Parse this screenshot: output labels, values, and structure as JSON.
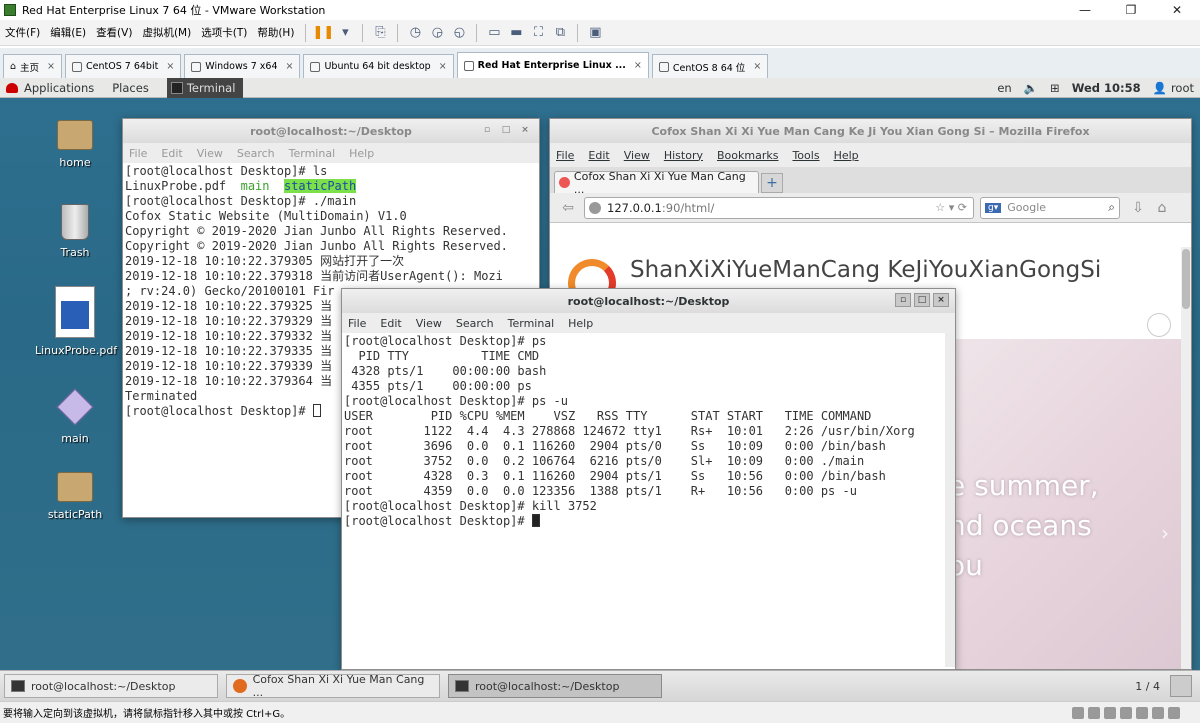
{
  "vmware": {
    "title": "Red Hat Enterprise Linux 7 64 位 - VMware Workstation",
    "window_controls": [
      "—",
      "❐",
      "✕"
    ],
    "menus": [
      "文件(F)",
      "编辑(E)",
      "查看(V)",
      "虚拟机(M)",
      "选项卡(T)",
      "帮助(H)"
    ],
    "tabs": [
      {
        "label": "主页",
        "active": false
      },
      {
        "label": "CentOS 7 64bit",
        "active": false
      },
      {
        "label": "Windows 7 x64",
        "active": false
      },
      {
        "label": "Ubuntu 64 bit desktop",
        "active": false
      },
      {
        "label": "Red Hat Enterprise Linux ...",
        "active": true
      },
      {
        "label": "CentOS 8 64 位",
        "active": false
      }
    ],
    "status_text": "要将输入定向到该虚拟机，请将鼠标指针移入其中或按 Ctrl+G。"
  },
  "gnome": {
    "applications": "Applications",
    "places": "Places",
    "task": "Terminal",
    "lang": "en",
    "clock": "Wed 10:58",
    "user": "root"
  },
  "desktop_icons": [
    {
      "label": "home"
    },
    {
      "label": "Trash"
    },
    {
      "label": "LinuxProbe.pdf"
    },
    {
      "label": "main"
    },
    {
      "label": "staticPath"
    }
  ],
  "term1": {
    "title": "root@localhost:~/Desktop",
    "menus": [
      "File",
      "Edit",
      "View",
      "Search",
      "Terminal",
      "Help"
    ],
    "lines": [
      "[root@localhost Desktop]# ls",
      "LinuxProbe.pdf  main  staticPath",
      "[root@localhost Desktop]# ./main",
      "Cofox Static Website (MultiDomain) V1.0",
      "Copyright © 2019-2020 Jian Junbo All Rights Reserved.",
      "Copyright © 2019-2020 Jian Junbo All Rights Reserved.",
      "2019-12-18 10:10:22.379305 网站打开了一次",
      "2019-12-18 10:10:22.379318 当前访问者UserAgent(): Mozi",
      "; rv:24.0) Gecko/20100101 Fir",
      "2019-12-18 10:10:22.379325 当",
      "2019-12-18 10:10:22.379329 当",
      "2019-12-18 10:10:22.379332 当",
      "2019-12-18 10:10:22.379335 当",
      "2019-12-18 10:10:22.379339 当",
      "2019-12-18 10:10:22.379364 当",
      "Terminated",
      "[root@localhost Desktop]# "
    ]
  },
  "firefox": {
    "title": "Cofox Shan Xi Xi Yue Man Cang Ke Ji You Xian Gong Si – Mozilla Firefox",
    "menus": [
      "File",
      "Edit",
      "View",
      "History",
      "Bookmarks",
      "Tools",
      "Help"
    ],
    "tab_label": "Cofox Shan Xi Xi Yue Man Cang ...",
    "new_tab": "+",
    "url_host": "127.0.0.1",
    "url_rest": ":90/html/",
    "search_placeholder": "Google",
    "site_title": "ShanXiXiYueManCang KeJiYouXianGongSi",
    "hero_lines": [
      "e summer,",
      "nd oceans",
      "ou"
    ]
  },
  "term2": {
    "title": "root@localhost:~/Desktop",
    "menus": [
      "File",
      "Edit",
      "View",
      "Search",
      "Terminal",
      "Help"
    ],
    "lines": [
      "[root@localhost Desktop]# ps",
      "  PID TTY          TIME CMD",
      " 4328 pts/1    00:00:00 bash",
      " 4355 pts/1    00:00:00 ps",
      "[root@localhost Desktop]# ps -u",
      "USER        PID %CPU %MEM    VSZ   RSS TTY      STAT START   TIME COMMAND",
      "root       1122  4.4  4.3 278868 124672 tty1    Rs+  10:01   2:26 /usr/bin/Xorg",
      "root       3696  0.0  0.1 116260  2904 pts/0    Ss   10:09   0:00 /bin/bash",
      "root       3752  0.0  0.2 106764  6216 pts/0    Sl+  10:09   0:00 ./main",
      "root       4328  0.3  0.1 116260  2904 pts/1    Ss   10:56   0:00 /bin/bash",
      "root       4359  0.0  0.0 123356  1388 pts/1    R+   10:56   0:00 ps -u",
      "[root@localhost Desktop]# kill 3752",
      "[root@localhost Desktop]# "
    ]
  },
  "bottom_panel": {
    "tasks": [
      {
        "label": "root@localhost:~/Desktop",
        "kind": "terminal",
        "active": false
      },
      {
        "label": "Cofox Shan Xi Xi Yue Man Cang ...",
        "kind": "firefox",
        "active": false
      },
      {
        "label": "root@localhost:~/Desktop",
        "kind": "terminal",
        "active": true
      }
    ],
    "workspace": "1 / 4"
  }
}
